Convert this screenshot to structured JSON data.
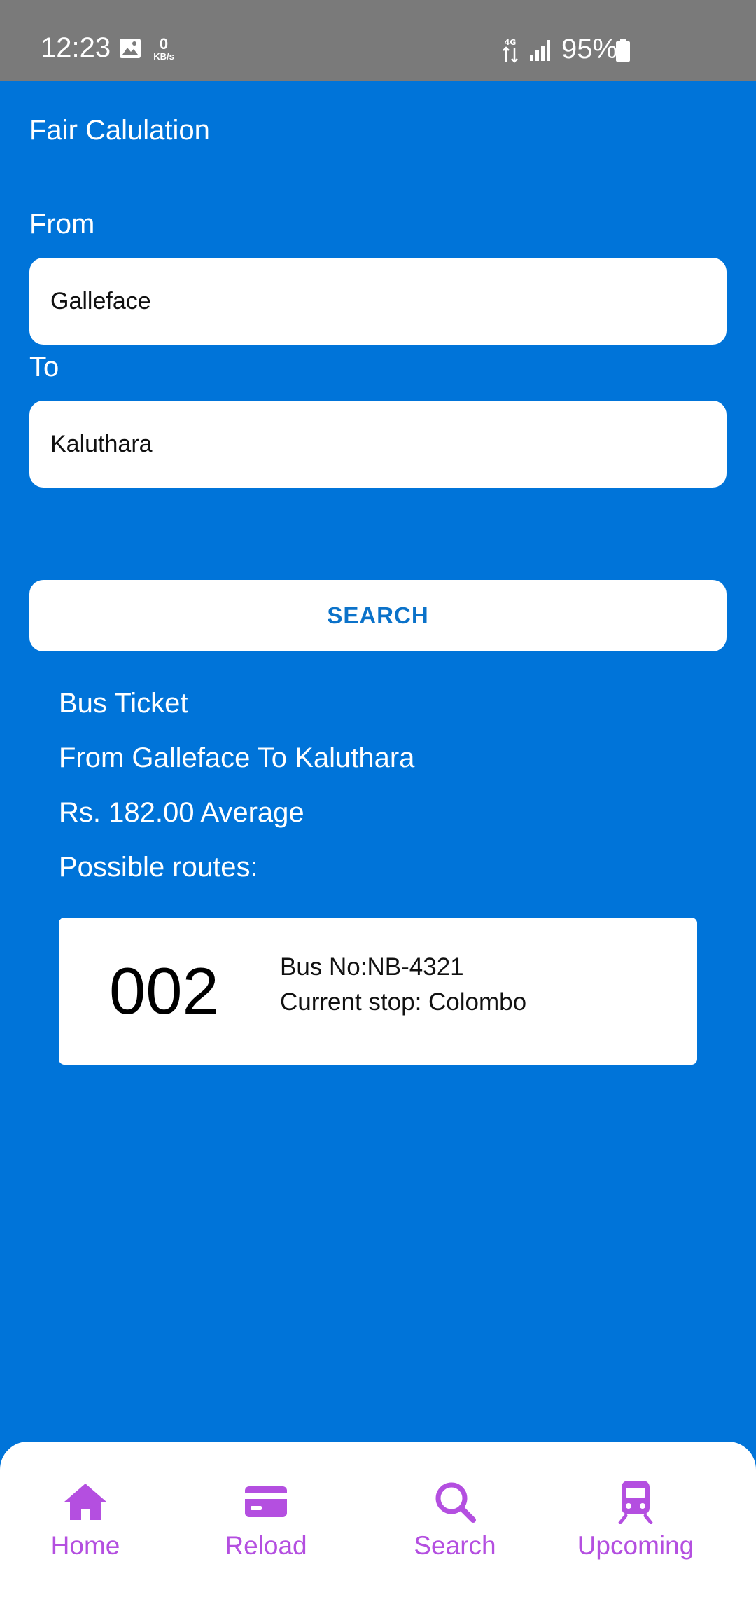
{
  "status_bar": {
    "time": "12:23",
    "network_speed_value": "0",
    "network_speed_unit": "KB/s",
    "battery_percent": "95%",
    "icons": [
      "gallery-icon",
      "network-4g-icon",
      "signal-icon",
      "battery-icon"
    ]
  },
  "app": {
    "title": "Fair Calulation"
  },
  "form": {
    "from_label": "From",
    "from_value": "Galleface",
    "to_label": "To",
    "to_value": "Kaluthara",
    "search_button": "SEARCH"
  },
  "result": {
    "heading": "Bus Ticket",
    "route_summary": "From Galleface To Kaluthara",
    "price": "Rs. 182.00 Average",
    "routes_label": "Possible routes:",
    "routes": [
      {
        "number": "002",
        "bus_no": "Bus No:NB-4321",
        "current_stop": "Current stop: Colombo"
      }
    ]
  },
  "bottom_nav": {
    "accent_color": "#b44fe0",
    "items": [
      {
        "label": "Home",
        "icon": "home-icon"
      },
      {
        "label": "Reload",
        "icon": "card-icon"
      },
      {
        "label": "Search",
        "icon": "search-icon"
      },
      {
        "label": "Upcoming",
        "icon": "train-icon"
      }
    ]
  },
  "colors": {
    "background": "#0074D9",
    "status_bar": "#7a7a7a",
    "button_text": "#0b72c9"
  }
}
